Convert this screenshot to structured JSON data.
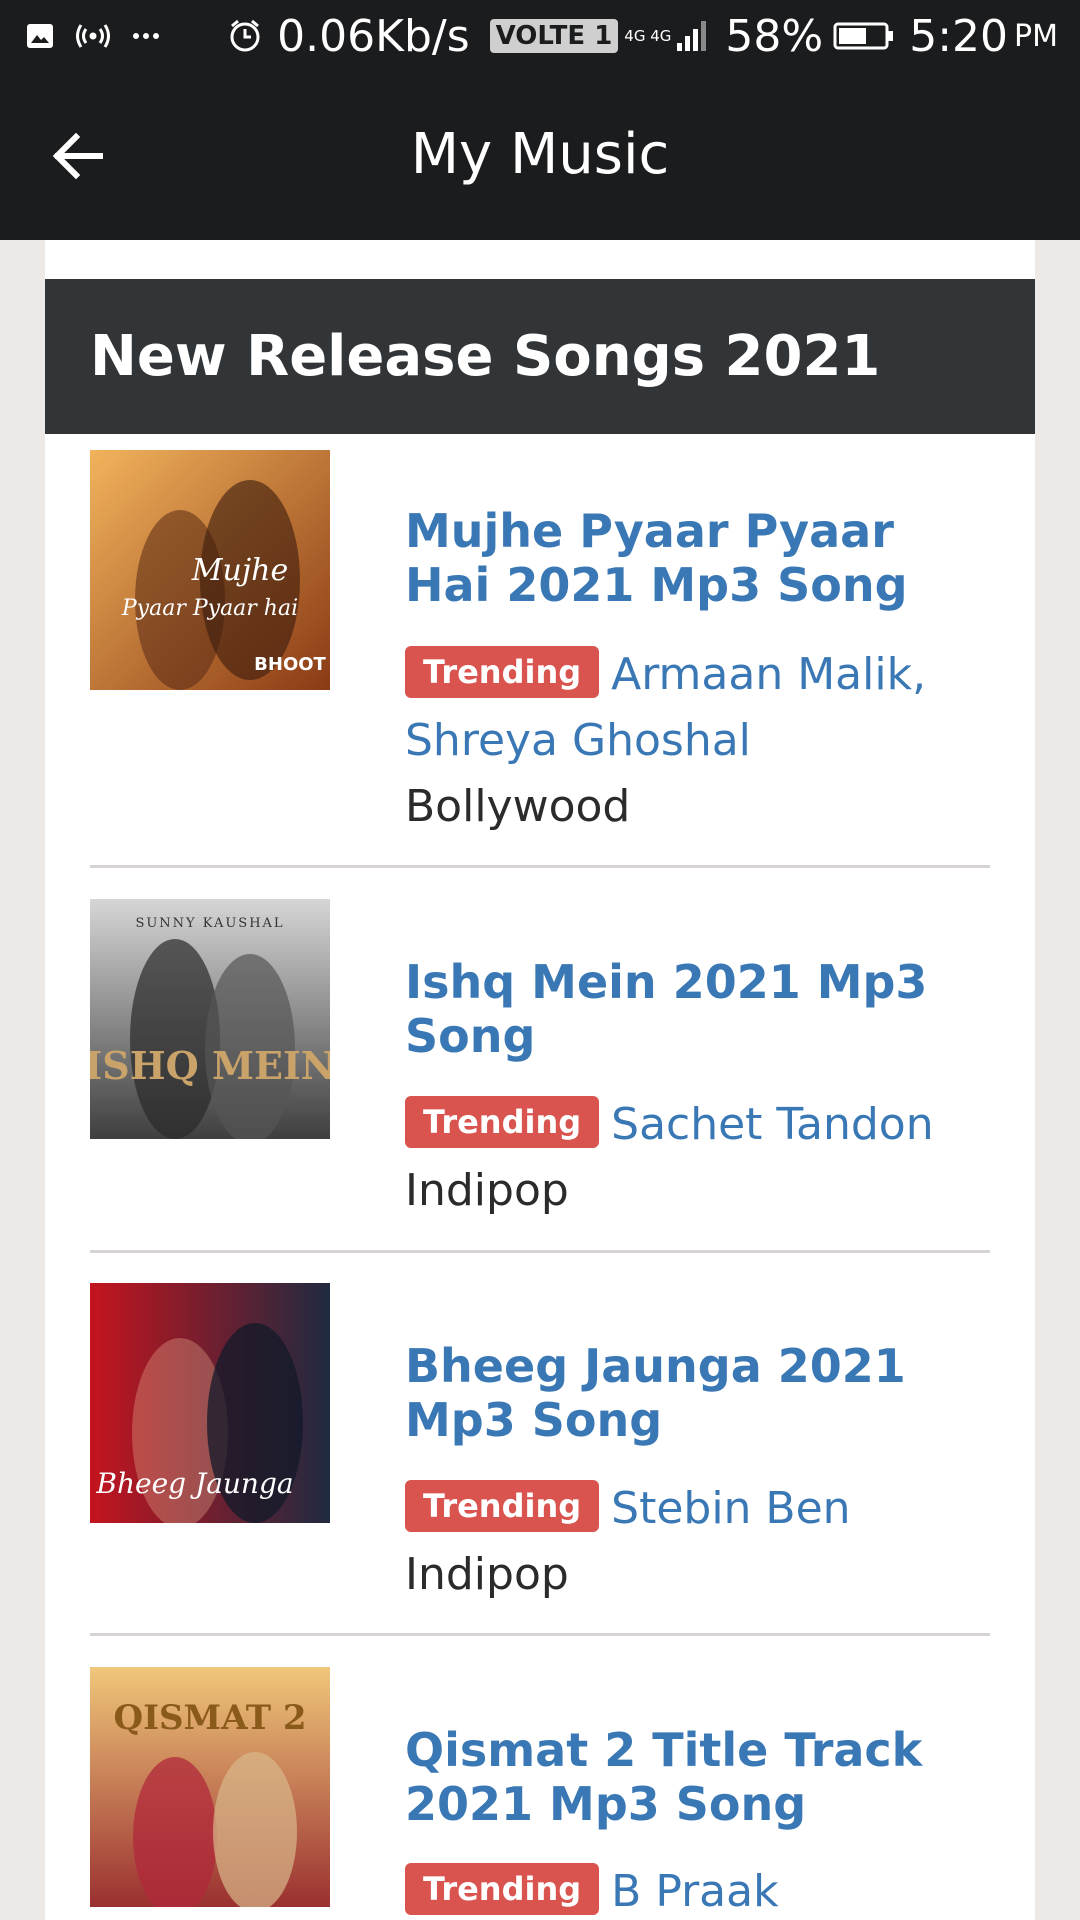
{
  "status_bar": {
    "speed": "0.06Kb/s",
    "volte": "VOLTE 1",
    "network": "4G 4G",
    "battery": "58%",
    "time": "5:20",
    "ampm": "PM"
  },
  "app_bar": {
    "title": "My Music",
    "back_icon": "arrow-left-icon"
  },
  "section": {
    "title": "New Release Songs 2021"
  },
  "songs": [
    {
      "title": "Mujhe Pyaar Pyaar Hai 2021 Mp3 Song",
      "badge": "Trending",
      "artist": "Armaan Malik, Shreya Ghoshal",
      "genre": "Bollywood",
      "thumb_text": "Mujhe Pyaar Pyaar hai",
      "thumb_colors": [
        "#c86a2a",
        "#f2b35c"
      ]
    },
    {
      "title": "Ishq Mein 2021 Mp3 Song",
      "badge": "Trending",
      "artist": "Sachet Tandon",
      "genre": "Indipop",
      "thumb_text": "ISHQ MEIN",
      "thumb_colors": [
        "#4a4a4a",
        "#bdbdbd"
      ]
    },
    {
      "title": "Bheeg Jaunga 2021 Mp3 Song",
      "badge": "Trending",
      "artist": "Stebin Ben",
      "genre": "Indipop",
      "thumb_text": "Bheeg Jaunga",
      "thumb_colors": [
        "#b3121c",
        "#2a3550"
      ]
    },
    {
      "title": "Qismat 2 Title Track 2021 Mp3 Song",
      "badge": "Trending",
      "artist": "B Praak",
      "genre": "",
      "thumb_text": "QISMAT 2",
      "thumb_colors": [
        "#d9a253",
        "#8a2b2b"
      ]
    }
  ]
}
